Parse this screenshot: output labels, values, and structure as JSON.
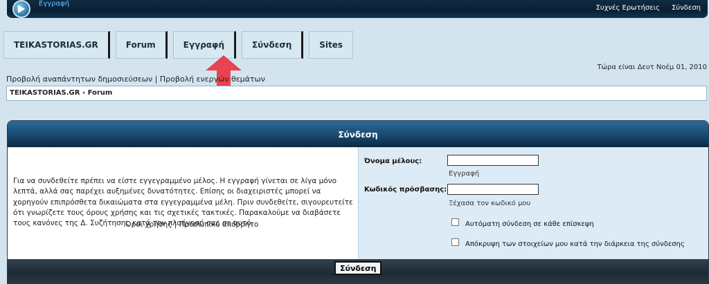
{
  "topbar": {
    "title": "Εγγραφή",
    "faq": "Συχνές Ερωτήσεις",
    "login": "Σύνδεση"
  },
  "tabs": [
    "TEIKASTORIAS.GR",
    "Forum",
    "Εγγραφή",
    "Σύνδεση",
    "Sites"
  ],
  "date_text": "Τώρα είναι Δευτ Νοέμ 01, 2010",
  "quicklinks": {
    "unanswered": "Προβολή αναπάντητων δημοσιεύσεων",
    "sep": "|",
    "active": "Προβολή ενεργών θεμάτων"
  },
  "breadcrumb": {
    "home": "TEIKASTORIAS.GR",
    "sep": "‹",
    "current": "Forum"
  },
  "panel": {
    "title": "Σύνδεση",
    "intro": "Για να συνδεθείτε πρέπει να είστε εγγεγραμμένο μέλος. Η εγγραφή γίνεται σε λίγα μόνο λεπτά, αλλά σας παρέχει αυξημένες δυνατότητες. Επίσης οι διαχειριστές μπορεί να χορηγούν επιπρόσθετα δικαιώματα στα εγγεγραμμένα μέλη. Πριν συνδεθείτε, σιγουρευτείτε ότι γνωρίζετε τους όρους χρήσης και τις σχετικές τακτικές. Παρακαλούμε να διαβάσετε τους κανόνες της Δ. Συζήτησης κατά την πλοήγησή σας σε αυτό.",
    "terms": "Όροι χρήσης",
    "links_sep": "|",
    "privacy": "Προσωπικό απόρρητο",
    "username_label": "Όνομα μέλους:",
    "username_value": "",
    "register_link": "Εγγραφή",
    "password_label": "Κωδικός πρόσβασης:",
    "password_value": "",
    "forgot_link": "Ξέχασα τον κωδικό μου",
    "autologin_label": "Αυτόματη σύνδεση σε κάθε επίσκεψη",
    "hide_label": "Απόκρυψη των στοιχείων μου κατά την διάρκεια της σύνδεσης",
    "submit": "Σύνδεση"
  },
  "colors": {
    "accent_arrow": "#e8434e",
    "header_blue": "#1c4f77"
  }
}
